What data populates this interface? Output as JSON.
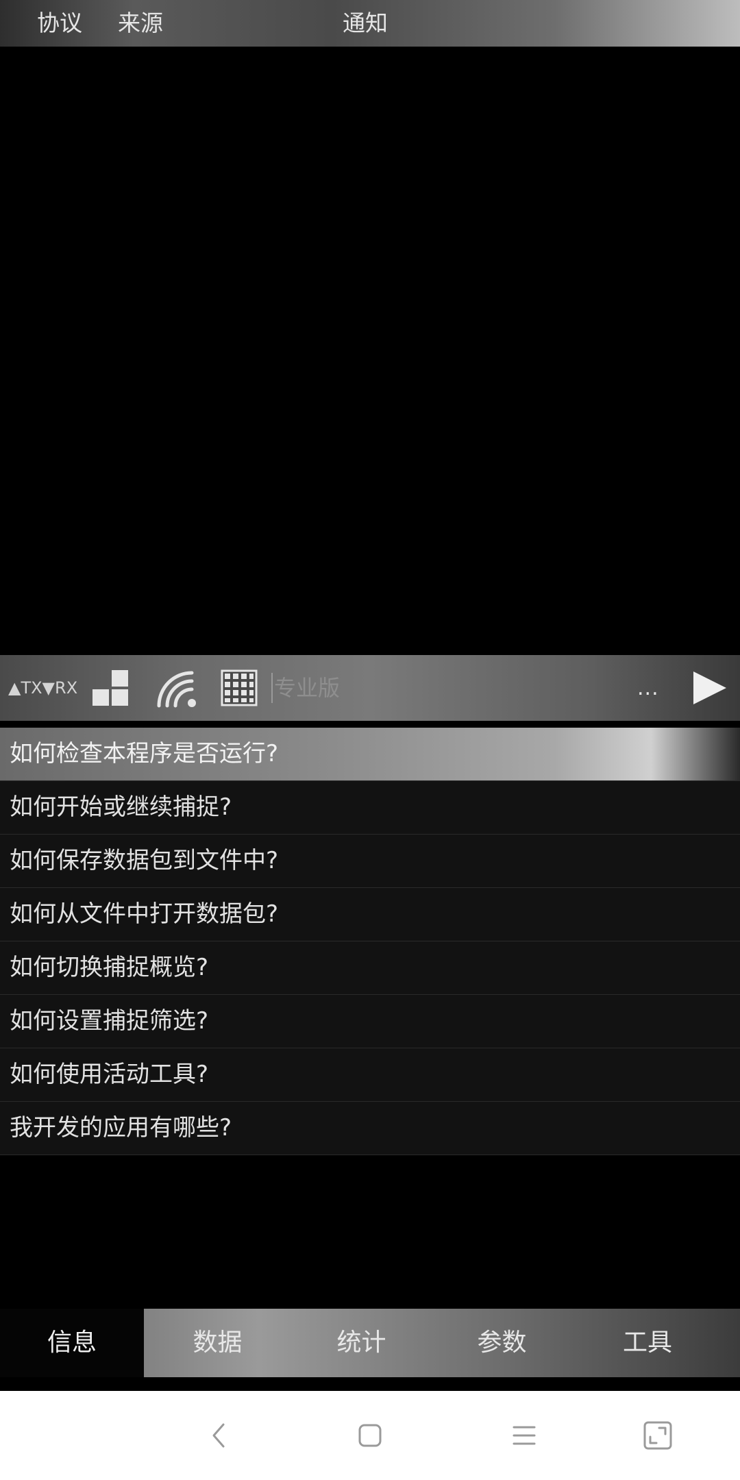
{
  "header": {
    "col_protocol": "协议",
    "col_source": "来源",
    "col_notice": "通知"
  },
  "toolbar": {
    "txrx_label": "▲TX▼RX",
    "pro_label": "专业版",
    "more_label": "..."
  },
  "faq": {
    "items": [
      "如何检查本程序是否运行?",
      "如何开始或继续捕捉?",
      "如何保存数据包到文件中?",
      "如何从文件中打开数据包?",
      "如何切换捕捉概览?",
      "如何设置捕捉筛选?",
      "如何使用活动工具?",
      "我开发的应用有哪些?"
    ]
  },
  "tabs": {
    "info": "信息",
    "data": "数据",
    "stats": "统计",
    "params": "参数",
    "tools": "工具"
  },
  "icons": {
    "blocks": "blocks-icon",
    "wifi": "wifi-icon",
    "grid": "grid-icon",
    "play": "play-icon",
    "back": "back-icon",
    "home": "home-icon",
    "menu": "menu-icon",
    "expand": "expand-icon"
  }
}
